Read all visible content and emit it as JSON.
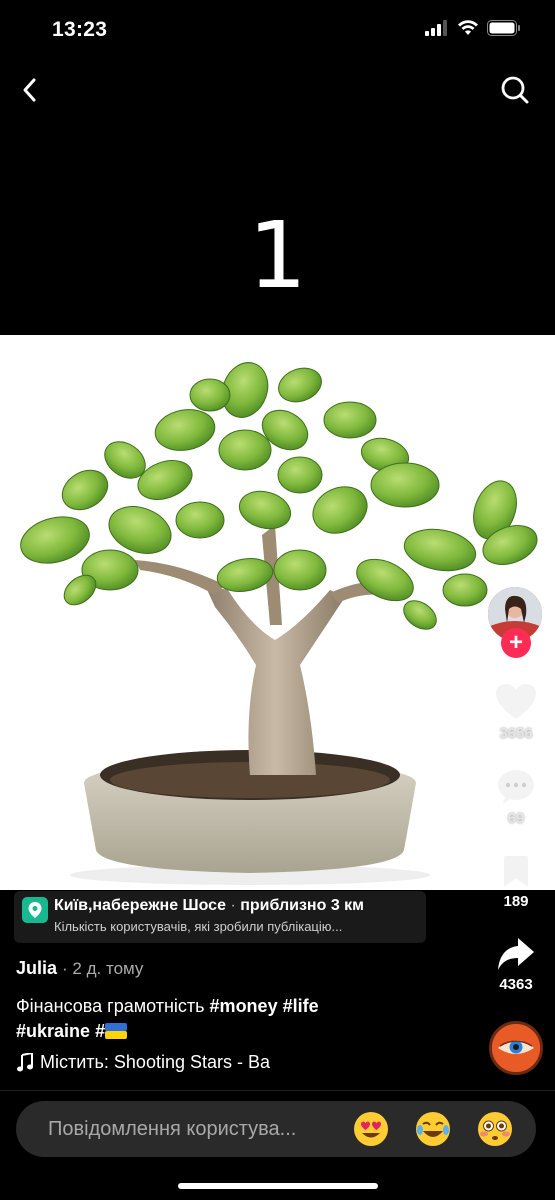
{
  "status": {
    "time": "13:23"
  },
  "slide": {
    "number": "1"
  },
  "rail": {
    "likes": "3656",
    "comments": "69",
    "saves": "189",
    "shares": "4363",
    "follow_symbol": "+"
  },
  "location": {
    "title": "Київ,набережне Шосе",
    "distance": "приблизно 3 км",
    "subtitle": "Кількість користувачів, які зробили публікацію..."
  },
  "post": {
    "author": "Julia",
    "time": "· 2 д. тому",
    "caption_text": "Фінансова грамотність ",
    "tag_money": "#money",
    "tag_life": "#life",
    "tag_ukraine": "#ukraine",
    "tag_hash": "#"
  },
  "sound": {
    "label": "Містить: Shooting Stars - Ba"
  },
  "comment": {
    "placeholder": "Повідомлення користува..."
  },
  "colors": {
    "accent": "#fe2c55",
    "location_pin": "#18b890"
  }
}
